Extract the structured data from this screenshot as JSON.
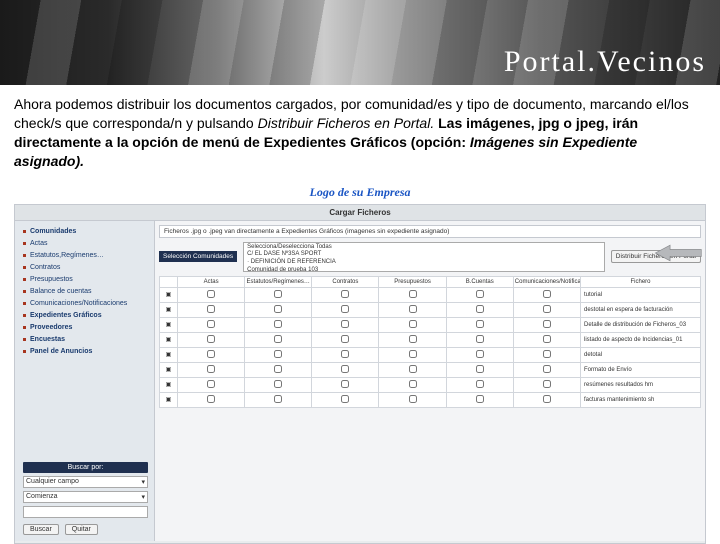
{
  "brand": "Portal.Vecinos",
  "desc": {
    "l1": "Ahora podemos distribuir los documentos cargados, por comunidad/es y tipo de",
    "l2_a": "documento, marcando el/los check/s que corresponda/n y pulsando ",
    "l2_b": "Distribuir Ficheros en Portal. ",
    "l3_a": "Las imágenes, jpg o jpeg, irán directamente a la opción de menú de Expedientes Gráficos (opción: ",
    "l3_b": "Imágenes sin Expediente asignado).",
    "l3_c": ""
  },
  "logo": "Logo de su Empresa",
  "app": {
    "title": "Cargar Ficheros",
    "sidebar": {
      "items": [
        "Comunidades",
        "Actas",
        "Estatutos,Regímenes…",
        "Contratos",
        "Presupuestos",
        "Balance de cuentas",
        "Comunicaciones/Notificaciones",
        "Expedientes Gráficos",
        "Proveedores",
        "Encuestas",
        "Panel de Anuncios"
      ],
      "filterLabel": "Buscar por:",
      "select1": "Cualquier campo",
      "select2": "Comienza",
      "btnSearch": "Buscar",
      "btnClear": "Quitar"
    },
    "notice": "Ficheros .jpg o .jpeg van directamente a Expedientes Gráficos (imagenes sin expediente asignado)",
    "selLabel": "Selección Comunidades",
    "listbox": [
      "Selecciona/Deselecciona Todas",
      "C/ EL DASE Nº3SA SPORT",
      "· DEFINICIÓN DE REFERENCIA",
      "Comunidad de prueba 103"
    ],
    "distBtn": "Distribuir Ficheros en Portal",
    "columns": [
      "",
      "Actas",
      "Estatutos/Regímenes…",
      "Contratos",
      "Presupuestos",
      "B.Cuentas",
      "Comunicaciones/Notificaciones",
      "Fichero"
    ],
    "files": [
      "tutorial",
      "destotal en espera de facturación",
      "Detalle de distribución de Ficheros_03",
      "listado de aspecto de Incidencias_01",
      "detotal",
      "Formato de Envío",
      "resúmenes resultados hm",
      "facturas mantenimiento sh"
    ]
  }
}
